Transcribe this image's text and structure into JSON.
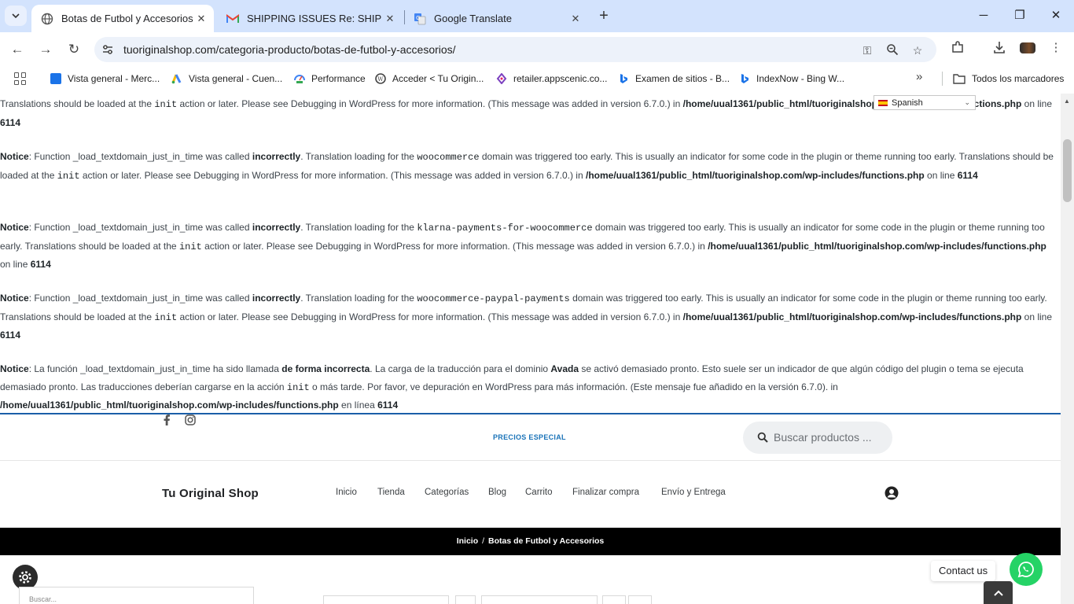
{
  "browser": {
    "tabs": [
      {
        "title": "Botas de Futbol y Accesorios ar",
        "active": true
      },
      {
        "title": "SHIPPING ISSUES Re: SHIPPING",
        "active": false
      },
      {
        "title": "Google Translate",
        "active": false
      }
    ],
    "url": "tuoriginalshop.com/categoria-producto/botas-de-futbol-y-accesorios/",
    "bookmarks": [
      "Vista general - Merc...",
      "Vista general - Cuen...",
      "Performance",
      "Acceder < Tu Origin...",
      "retailer.appscenic.co...",
      "Examen de sitios - B...",
      "IndexNow - Bing W..."
    ],
    "all_bookmarks": "Todos los marcadores"
  },
  "translate": {
    "language": "Spanish"
  },
  "notices": [
    {
      "pre": "",
      "parts_line1": "Translations should be loaded at the ",
      "code1": "init",
      "rest1": " action or later. Please see Debugging in WordPress for more information. (This message was added in version 6.7.0.) in ",
      "path": "/home/uual1361/public_html/tuoriginalshop.com/wp-includes/functions.php",
      "online": " on line ",
      "line": "6114"
    },
    {
      "label": "Notice",
      "a": ": Function _load_textdomain_just_in_time was called ",
      "strong": "incorrectly",
      "b": ". Translation loading for the ",
      "domain": "woocommerce",
      "c": " domain was triggered too early. This is usually an indicator for some code in the plugin or theme running too early. Translations should be loaded at the ",
      "code": "init",
      "d": " action or later. Please see Debugging in WordPress for more information. (This message was added in version 6.7.0.) in ",
      "path": "/home/uual1361/public_html/tuoriginalshop.com/wp-includes/functions.php",
      "online": " on line ",
      "line": "6114"
    },
    {
      "label": "Notice",
      "a": ": Function _load_textdomain_just_in_time was called ",
      "strong": "incorrectly",
      "b": ". Translation loading for the ",
      "domain": "klarna-payments-for-woocommerce",
      "c": " domain was triggered too early. This is usually an indicator for some code in the plugin or theme running too early. Translations should be loaded at the ",
      "code": "init",
      "d": " action or later. Please see Debugging in WordPress for more information. (This message was added in version 6.7.0.) in ",
      "path": "/home/uual1361/public_html/tuoriginalshop.com/wp-includes/functions.php",
      "online": " on line ",
      "line": "6114"
    },
    {
      "label": "Notice",
      "a": ": Function _load_textdomain_just_in_time was called ",
      "strong": "incorrectly",
      "b": ". Translation loading for the ",
      "domain": "woocommerce-paypal-payments",
      "c": " domain was triggered too early. This is usually an indicator for some code in the plugin or theme running too early. Translations should be loaded at the ",
      "code": "init",
      "d": " action or later. Please see Debugging in WordPress for more information. (This message was added in version 6.7.0.) in ",
      "path": "/home/uual1361/public_html/tuoriginalshop.com/wp-includes/functions.php",
      "online": " on line ",
      "line": "6114"
    },
    {
      "label": "Notice",
      "a": ": La función _load_textdomain_just_in_time ha sido llamada ",
      "strong": "de forma incorrecta",
      "b": ". La carga de la traducción para el dominio ",
      "domain": "Avada",
      "c": " se activó demasiado pronto. Esto suele ser un indicador de que algún código del plugin o tema se ejecuta demasiado pronto. Las traducciones deberían cargarse en la acción ",
      "code": "init",
      "d": " o más tarde. Por favor, ve depuración en WordPress para más información. (Este mensaje fue añadido en la versión 6.7.0). in ",
      "path": "/home/uual1361/public_html/tuoriginalshop.com/wp-includes/functions.php",
      "online": " en línea ",
      "line": "6114"
    }
  ],
  "header": {
    "promo": "PRECIOS ESPECIAL",
    "search_placeholder": "Buscar productos ...",
    "brand": "Tu Original Shop",
    "menu": [
      "Inicio",
      "Tienda",
      "Categorías",
      "Blog",
      "Carrito",
      "Finalizar compra",
      "Envío y Entrega"
    ]
  },
  "breadcrumb": {
    "home": "Inicio",
    "separator": "/",
    "current": "Botas de Futbol y Accesorios"
  },
  "sidebar": {
    "search_placeholder": "Buscar..."
  },
  "contact": {
    "label": "Contact us"
  },
  "colors": {
    "accent": "#1b5fa8",
    "whatsapp": "#25d366",
    "breadcrumb_bg": "#000000"
  }
}
